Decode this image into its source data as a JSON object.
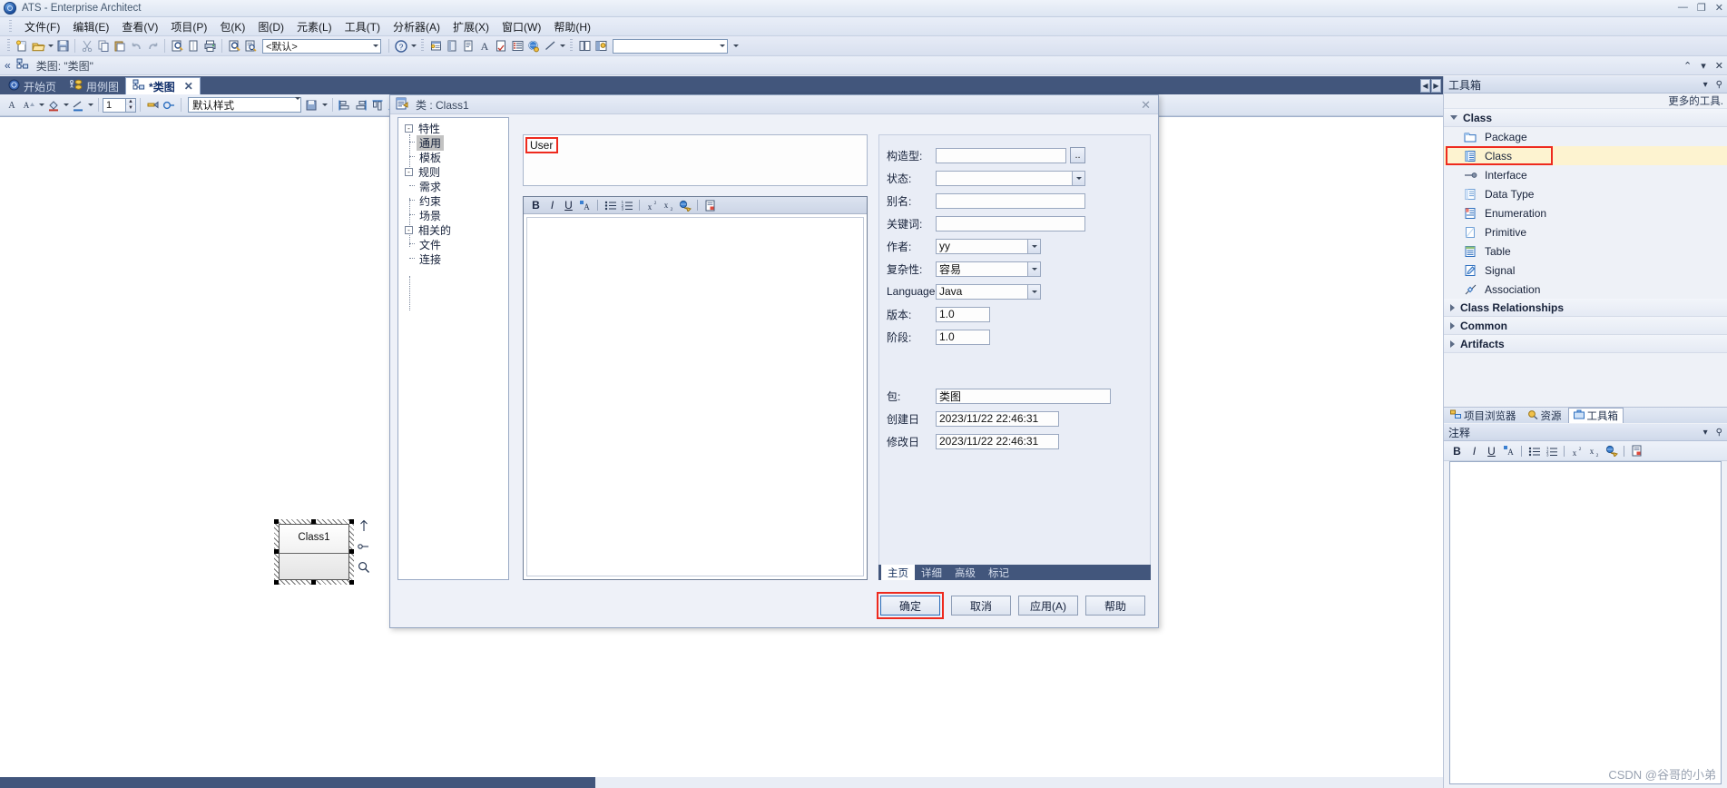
{
  "window": {
    "title": "ATS - Enterprise Architect",
    "minimize": "—",
    "maximize": "❐",
    "close": "✕"
  },
  "menu": {
    "items": [
      {
        "label": "文件(F)"
      },
      {
        "label": "编辑(E)"
      },
      {
        "label": "查看(V)"
      },
      {
        "label": "项目(P)"
      },
      {
        "label": "包(K)"
      },
      {
        "label": "图(D)"
      },
      {
        "label": "元素(L)"
      },
      {
        "label": "工具(T)"
      },
      {
        "label": "分析器(A)"
      },
      {
        "label": "扩展(X)"
      },
      {
        "label": "窗口(W)"
      },
      {
        "label": "帮助(H)"
      }
    ]
  },
  "toolbar": {
    "perspective_value": "<默认>",
    "perspective_placeholder": "<默认>",
    "search_value": "",
    "icons": [
      "new-project-icon",
      "open-project-icon",
      "save-icon",
      "cut-icon",
      "copy-icon",
      "paste-icon",
      "undo-icon",
      "redo-icon",
      "print-preview-icon",
      "page-setup-icon",
      "print-icon",
      "find-icon",
      "model-search-icon",
      "help-icon",
      "quick-start-icon",
      "document-icon",
      "report-icon",
      "text-icon",
      "spell-icon",
      "list-icon",
      "globe-icon",
      "line-icon",
      "layout-icon",
      "workspace-icon"
    ]
  },
  "breadcrumb": {
    "back_icon": "«",
    "diagram_icon": "class-diagram-icon",
    "text": "类图: \"类图\"",
    "collapse": "⌃",
    "dropdown": "▾",
    "close": "✕"
  },
  "diagram_tabs": {
    "items": [
      {
        "label": "开始页",
        "icon": "start-page-icon",
        "active": false
      },
      {
        "label": "用例图",
        "icon": "usecase-diagram-icon",
        "active": false
      },
      {
        "label": "*类图",
        "icon": "class-diagram-icon",
        "active": true,
        "close": "✕"
      }
    ],
    "nav_prev": "◀",
    "nav_next": "▶"
  },
  "format_toolbar": {
    "zoom_value": "1",
    "style_value": "默认样式",
    "icons": [
      "font-color-icon",
      "font-style-icon",
      "fill-color-icon",
      "line-color-icon",
      "line-width-icon",
      "paint-format-icon",
      "format-copy-icon",
      "align-left-icon",
      "align-center-icon",
      "align-top-icon",
      "align-bottom-icon"
    ]
  },
  "canvas": {
    "class_node": {
      "name": "Class1",
      "tools": [
        "move-up-icon",
        "link-icon",
        "zoom-icon"
      ]
    }
  },
  "dialog": {
    "title": "类 : Class1",
    "title_icon": "properties-icon",
    "close": "✕",
    "tree": [
      {
        "label": "特性",
        "level": 0,
        "expander": "-",
        "selected": false
      },
      {
        "label": "通用",
        "level": 1,
        "selected": true
      },
      {
        "label": "模板",
        "level": 1,
        "selected": false
      },
      {
        "label": "规则",
        "level": 0,
        "expander": "-",
        "selected": false
      },
      {
        "label": "需求",
        "level": 1,
        "selected": false
      },
      {
        "label": "约束",
        "level": 1,
        "selected": false
      },
      {
        "label": "场景",
        "level": 1,
        "selected": false
      },
      {
        "label": "相关的",
        "level": 0,
        "expander": "-",
        "selected": false
      },
      {
        "label": "文件",
        "level": 1,
        "selected": false
      },
      {
        "label": "连接",
        "level": 1,
        "selected": false
      }
    ],
    "name_value": "User",
    "notes_placeholder": "",
    "notes_value": "",
    "note_toolbar_icons": [
      "bold-icon",
      "italic-icon",
      "underline-icon",
      "font-color-icon",
      "bullet-list-icon",
      "numbered-list-icon",
      "superscript-icon",
      "subscript-icon",
      "hyperlink-icon",
      "insert-object-icon"
    ],
    "fields": {
      "stereotype": {
        "label": "构造型:",
        "value": "",
        "browse": ".."
      },
      "status": {
        "label": "状态:",
        "value": ""
      },
      "alias": {
        "label": "别名:",
        "value": ""
      },
      "keyword": {
        "label": "关键词:",
        "value": ""
      },
      "author": {
        "label": "作者:",
        "value": "yy"
      },
      "complexity": {
        "label": "复杂性:",
        "value": "容易"
      },
      "language": {
        "label": "Language:",
        "value": "Java"
      },
      "version": {
        "label": "版本:",
        "value": "1.0"
      },
      "phase": {
        "label": "阶段:",
        "value": "1.0"
      },
      "package": {
        "label": "包:",
        "value": "类图"
      },
      "created": {
        "label": "创建日",
        "value": "2023/11/22 22:46:31"
      },
      "modified": {
        "label": "修改日",
        "value": "2023/11/22 22:46:31"
      }
    },
    "bottom_tabs": [
      {
        "label": "主页",
        "active": true
      },
      {
        "label": "详细",
        "active": false
      },
      {
        "label": "高级",
        "active": false
      },
      {
        "label": "标记",
        "active": false
      }
    ],
    "buttons": [
      {
        "label": "确定",
        "name": "ok-button",
        "highlighted": true
      },
      {
        "label": "取消",
        "name": "cancel-button",
        "highlighted": false
      },
      {
        "label": "应用(A)",
        "name": "apply-button",
        "highlighted": false
      },
      {
        "label": "帮助",
        "name": "help-button",
        "highlighted": false
      }
    ]
  },
  "toolbox": {
    "title": "工具箱",
    "dropdown": "▾",
    "pin": "⚲",
    "more_tools": "更多的工具.",
    "groups": [
      {
        "label": "Class",
        "open": true,
        "items": [
          {
            "label": "Package",
            "icon": "package-icon",
            "selected": false
          },
          {
            "label": "Class",
            "icon": "class-icon",
            "selected": true
          },
          {
            "label": "Interface",
            "icon": "interface-icon",
            "selected": false
          },
          {
            "label": "Data Type",
            "icon": "datatype-icon",
            "selected": false
          },
          {
            "label": "Enumeration",
            "icon": "enumeration-icon",
            "selected": false
          },
          {
            "label": "Primitive",
            "icon": "primitive-icon",
            "selected": false
          },
          {
            "label": "Table",
            "icon": "table-icon",
            "selected": false
          },
          {
            "label": "Signal",
            "icon": "signal-icon",
            "selected": false
          },
          {
            "label": "Association",
            "icon": "association-icon",
            "selected": false
          }
        ]
      },
      {
        "label": "Class Relationships",
        "open": false,
        "items": []
      },
      {
        "label": "Common",
        "open": false,
        "items": []
      },
      {
        "label": "Artifacts",
        "open": false,
        "items": []
      }
    ]
  },
  "dock_tabs": [
    {
      "label": "项目浏览器",
      "icon": "project-browser-icon",
      "active": false
    },
    {
      "label": "资源",
      "icon": "resources-icon",
      "active": false
    },
    {
      "label": "工具箱",
      "icon": "toolbox-icon",
      "active": true
    }
  ],
  "notes_panel": {
    "title": "注释",
    "dropdown": "▾",
    "pin": "⚲",
    "toolbar_icons": [
      "bold-icon",
      "italic-icon",
      "underline-icon",
      "font-color-icon",
      "bullet-list-icon",
      "numbered-list-icon",
      "superscript-icon",
      "subscript-icon",
      "hyperlink-icon",
      "insert-object-icon"
    ],
    "content": ""
  },
  "watermark": "CSDN @谷哥的小弟"
}
